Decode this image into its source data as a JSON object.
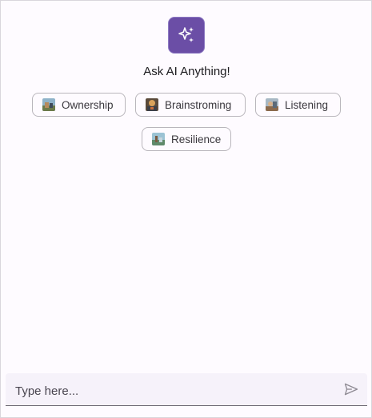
{
  "header": {
    "logo_icon": "sparkles-icon",
    "title": "Ask AI Anything!"
  },
  "suggestions": [
    {
      "label": "Ownership",
      "icon": "image-thumbnail-icon"
    },
    {
      "label": "Brainstroming",
      "icon": "image-thumbnail-icon"
    },
    {
      "label": "Listening",
      "icon": "image-thumbnail-icon"
    },
    {
      "label": "Resilience",
      "icon": "image-thumbnail-icon"
    }
  ],
  "composer": {
    "placeholder": "Type here...",
    "send_icon": "send-icon"
  },
  "colors": {
    "accent": "#6b4ea6",
    "background": "#fefbff",
    "chip_border": "#b9b6bc",
    "input_bg": "#f6f2fa"
  }
}
